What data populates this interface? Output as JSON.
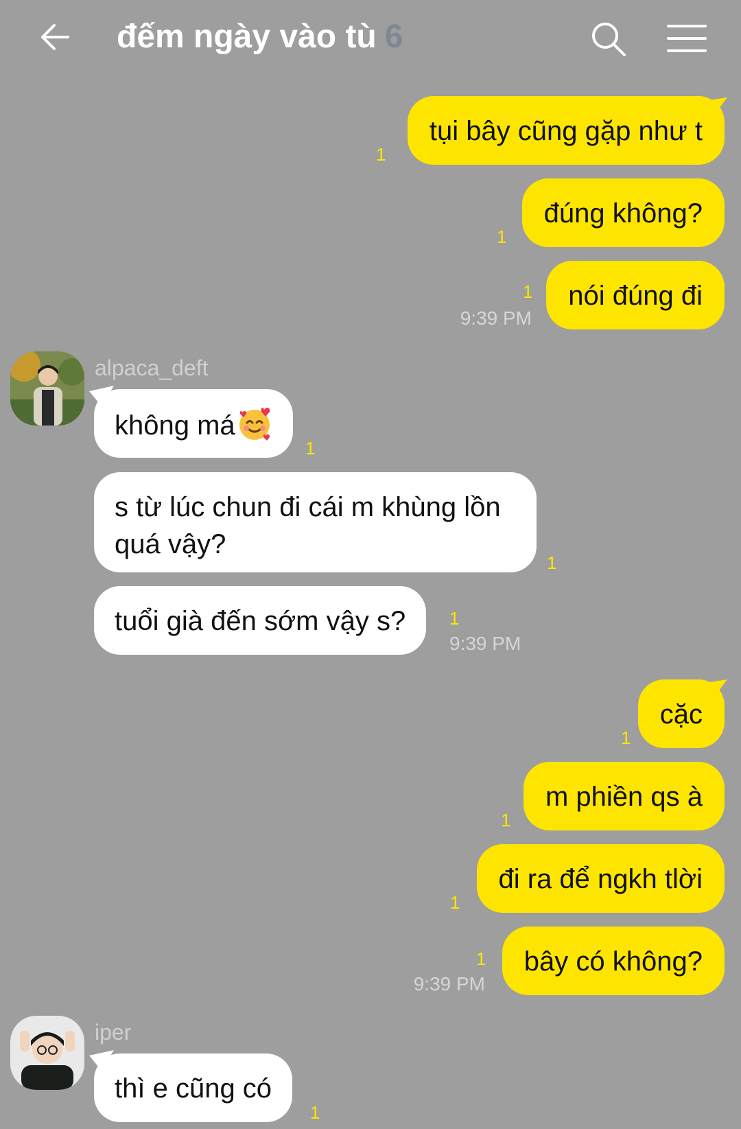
{
  "header": {
    "title": "đếm ngày vào tù",
    "member_count": "6"
  },
  "messages": {
    "m1": "tụi bây cũng gặp như t",
    "m2": "đúng không?",
    "m3": "nói đúng đi",
    "m4_text": "không má",
    "m4_emoji": "smiling-face-with-hearts",
    "m5": "s từ lúc chun đi cái m khùng lồn quá vậy?",
    "m6": "tuổi già đến sớm vậy s?",
    "m7": "cặc",
    "m8": "m phiền qs à",
    "m9": "đi ra để ngkh tlời",
    "m10": "bây có không?",
    "m11": "thì e cũng có"
  },
  "unread_mark": "1",
  "times": {
    "t1": "9:39 PM",
    "t2": "9:39 PM",
    "t3": "9:39 PM"
  },
  "senders": {
    "s1": "alpaca_deft",
    "s2": "iper"
  },
  "colors": {
    "background": "#9e9e9e",
    "outgoing_bubble": "#fee500",
    "incoming_bubble": "#ffffff",
    "unread": "#fee500"
  }
}
